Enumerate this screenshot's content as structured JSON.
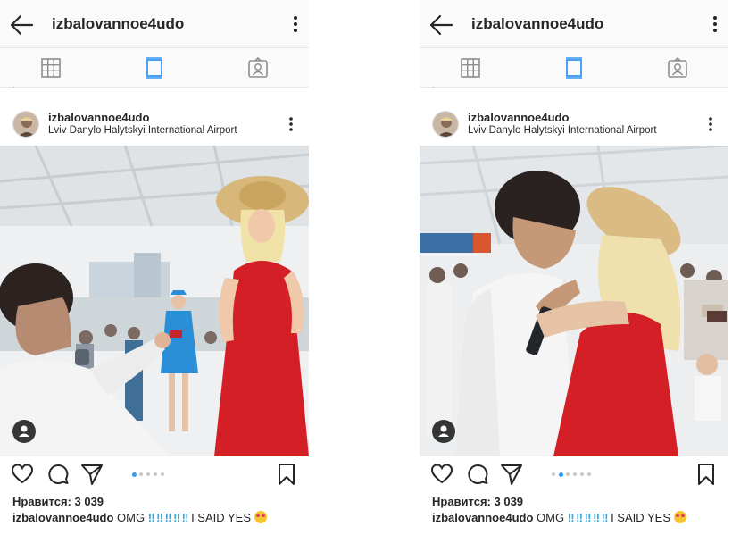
{
  "posts": [
    {
      "header_title": "izbalovannoe4udo",
      "cutoff_text": "· ........ ........",
      "username": "izbalovannoe4udo",
      "location": "Lviv Danylo Halytskyi International Airport",
      "carousel_active_index": 0,
      "carousel_count": 5,
      "likes": "Нравится: 3 039",
      "caption_user": "izbalovannoe4udo",
      "caption_omg": "OMG",
      "caption_bangs": "‼ ‼ ‼ ‼ ‼",
      "caption_tail": "I SAID YES"
    },
    {
      "header_title": "izbalovannoe4udo",
      "cutoff_text": "· ........ ........",
      "username": "izbalovannoe4udo",
      "location": "Lviv Danylo Halytskyi International Airport",
      "carousel_active_index": 1,
      "carousel_count": 6,
      "likes": "Нравится: 3 039",
      "caption_user": "izbalovannoe4udo",
      "caption_omg": "OMG",
      "caption_bangs": "‼ ‼ ‼ ‼ ‼",
      "caption_tail": "I SAID YES"
    }
  ],
  "icons": {
    "back": "arrow-left-icon",
    "menu": "more-vertical-icon",
    "grid": "grid-icon",
    "feed": "feed-icon",
    "tagged": "tagged-icon",
    "like": "heart-icon",
    "comment": "comment-icon",
    "share": "send-icon",
    "save": "bookmark-icon",
    "user_tag": "user-tag-icon",
    "emoji": "heart-eyes-emoji-icon"
  },
  "colors": {
    "accent": "#3897f0",
    "text": "#262626",
    "muted": "#8e8e8e",
    "bar_bg": "#fafafa",
    "dress_red": "#d41f26",
    "uniform_blue": "#2a8fd6"
  }
}
